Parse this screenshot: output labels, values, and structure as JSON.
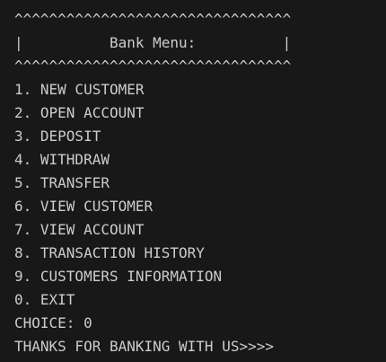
{
  "terminal": {
    "border_top": "^^^^^^^^^^^^^^^^^^^^^^^^^^^^^^^^",
    "title_line": "|          Bank Menu:          |",
    "border_bottom": "^^^^^^^^^^^^^^^^^^^^^^^^^^^^^^^^",
    "menu": [
      "1. NEW CUSTOMER",
      "2. OPEN ACCOUNT",
      "3. DEPOSIT",
      "4. WITHDRAW",
      "5. TRANSFER",
      "6. VIEW CUSTOMER",
      "7. VIEW ACCOUNT",
      "8. TRANSACTION HISTORY",
      "9. CUSTOMERS INFORMATION",
      "0. EXIT"
    ],
    "prompt": "CHOICE: 0",
    "farewell": "THANKS FOR BANKING WITH US>>>>"
  },
  "colors": {
    "background": "#181818",
    "text": "#cccccc"
  }
}
